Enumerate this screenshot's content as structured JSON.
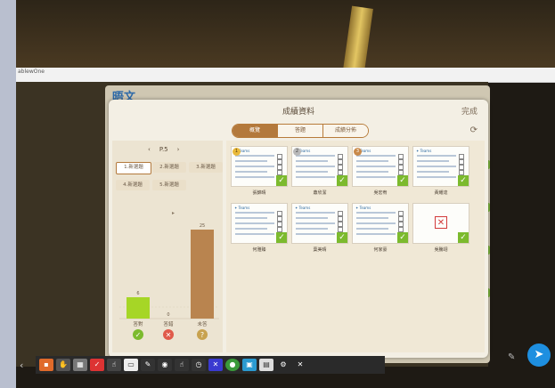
{
  "window": {
    "title": "ablewOne"
  },
  "app": {
    "logo_text": "晤文"
  },
  "dialog": {
    "title": "成績資料",
    "done_label": "完成",
    "tabs": [
      {
        "label": "概覽",
        "active": true
      },
      {
        "label": "答題",
        "active": false
      },
      {
        "label": "成績分佈",
        "active": false
      }
    ]
  },
  "left_panel": {
    "pager": {
      "prev": "‹",
      "page": "P.5",
      "next": "›"
    },
    "questions": [
      "1.新選題",
      "2.新選題",
      "3.新選題",
      "4.新選題",
      "5.新選題"
    ],
    "active_question": 0
  },
  "chart_data": {
    "type": "bar",
    "categories": [
      "答對",
      "答錯",
      "未答"
    ],
    "values": [
      6,
      0,
      25
    ],
    "colors": [
      "#a6d626",
      "#d54a3a",
      "#b9844f"
    ],
    "icons": [
      "✓",
      "✕",
      "?"
    ],
    "icon_colors": [
      "#7cba2e",
      "#e05a4a",
      "#c8a24f"
    ],
    "ylim": [
      0,
      25
    ]
  },
  "students": [
    {
      "name": "張錦晴",
      "rank": "1",
      "rank_style": "gold",
      "status": "check"
    },
    {
      "name": "蕭欣潔",
      "rank": "2",
      "rank_style": "silver",
      "status": "check"
    },
    {
      "name": "吳宏宥",
      "rank": "3",
      "rank_style": "bronze",
      "status": "check"
    },
    {
      "name": "黃耀達",
      "rank": "",
      "rank_style": "",
      "status": "check"
    },
    {
      "name": "何雅臻",
      "rank": "",
      "rank_style": "",
      "status": "check"
    },
    {
      "name": "葉美晴",
      "rank": "",
      "rank_style": "",
      "status": "check"
    },
    {
      "name": "何家豪",
      "rank": "",
      "rank_style": "",
      "status": "check"
    },
    {
      "name": "吳騰翊",
      "rank": "",
      "rank_style": "",
      "status": "missing"
    }
  ],
  "sheet": {
    "header": "✦ Teams"
  }
}
